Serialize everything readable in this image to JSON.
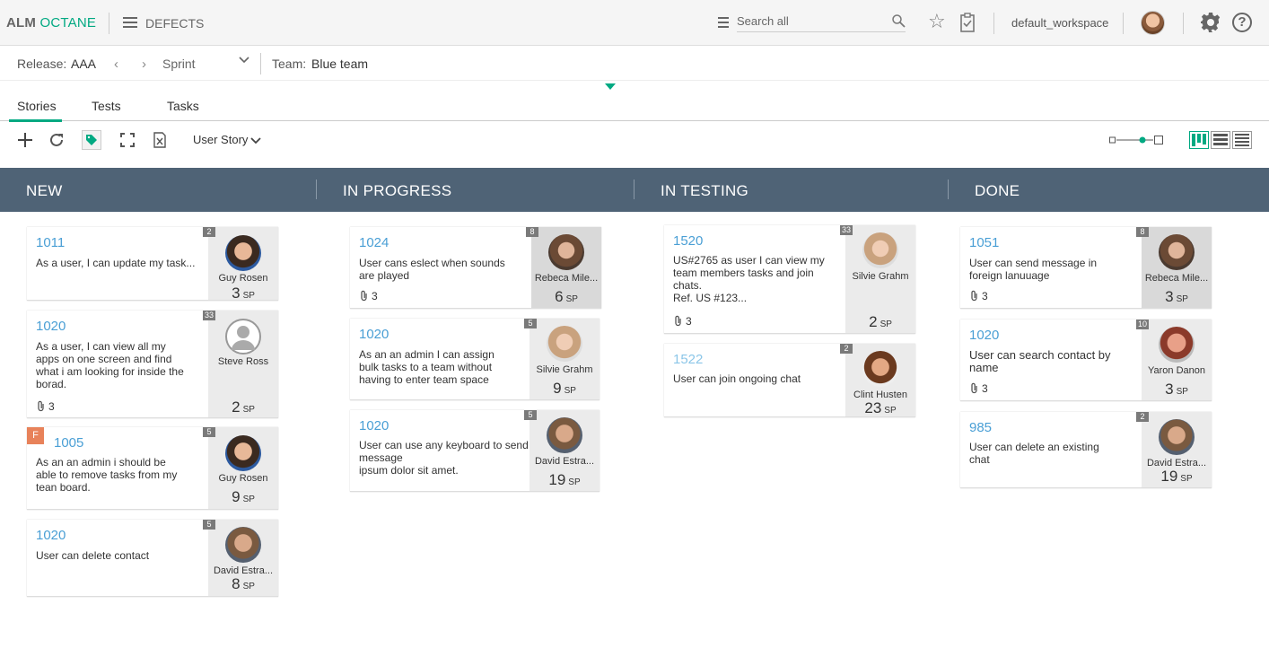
{
  "app": {
    "logo_bold": "ALM",
    "logo_accent": "OCTANE",
    "module": "DEFECTS",
    "search_placeholder": "Search all",
    "workspace": "default_workspace"
  },
  "filters": {
    "release_label": "Release:",
    "release_value": "AAA",
    "sprint_value": "Sprint",
    "team_label": "Team:",
    "team_value": "Blue team"
  },
  "tabs": [
    "Stories",
    "Tests",
    "Tasks"
  ],
  "toolbar": {
    "entity_type": "User Story"
  },
  "lanes": [
    "NEW",
    "IN PROGRESS",
    "IN TESTING",
    "DONE"
  ],
  "cards": {
    "new": [
      {
        "id": "1011",
        "title": "As a user, I can update my task...",
        "badge": "2",
        "owner": "Guy Rosen",
        "sp": "3",
        "attach": ""
      },
      {
        "id": "1020",
        "title": "As a user, I can view all my apps on one screen and find what i am looking for inside the borad.",
        "badge": "33",
        "owner": "Steve Ross",
        "sp": "2",
        "attach": "3"
      },
      {
        "id": "1005",
        "title": "As an an admin i should be able to remove tasks from my tean board.",
        "badge": "5",
        "owner": "Guy Rosen",
        "sp": "9",
        "attach": "",
        "flag": "F"
      },
      {
        "id": "1020",
        "title": "User can delete contact",
        "badge": "5",
        "owner": "David Estra...",
        "sp": "8",
        "attach": ""
      }
    ],
    "progress": [
      {
        "id": "1024",
        "title": "User cans eslect when sounds are played",
        "badge": "8",
        "owner": "Rebeca Mile...",
        "sp": "6",
        "attach": "3"
      },
      {
        "id": "1020",
        "title": "As an an admin I can assign bulk tasks to a team without having to enter team space",
        "badge": "5",
        "owner": "Silvie Grahm",
        "sp": "9",
        "attach": ""
      },
      {
        "id": "1020",
        "title": "User can use any keyboard to send message\nipsum dolor sit amet.",
        "badge": "5",
        "owner": "David Estra...",
        "sp": "19",
        "attach": ""
      }
    ],
    "testing": [
      {
        "id": "1520",
        "title": "US#2765 as user I can view my team members tasks and join chats.\nRef. US #123...",
        "badge": "33",
        "owner": "Silvie Grahm",
        "sp": "2",
        "attach": "3"
      },
      {
        "id": "1522",
        "title": "User can join ongoing chat",
        "badge": "2",
        "owner": "Clint Husten",
        "sp": "23",
        "attach": ""
      }
    ],
    "done": [
      {
        "id": "1051",
        "title": "User can send message in foreign lanuuage",
        "badge": "8",
        "owner": "Rebeca Mile...",
        "sp": "3",
        "attach": "3"
      },
      {
        "id": "1020",
        "title": "User can search contact by name",
        "badge": "10",
        "owner": "Yaron Danon",
        "sp": "3",
        "attach": "3"
      },
      {
        "id": "985",
        "title": "User can delete an existing chat",
        "badge": "2",
        "owner": "David Estra...",
        "sp": "19",
        "attach": ""
      }
    ]
  },
  "sp_unit": "SP"
}
